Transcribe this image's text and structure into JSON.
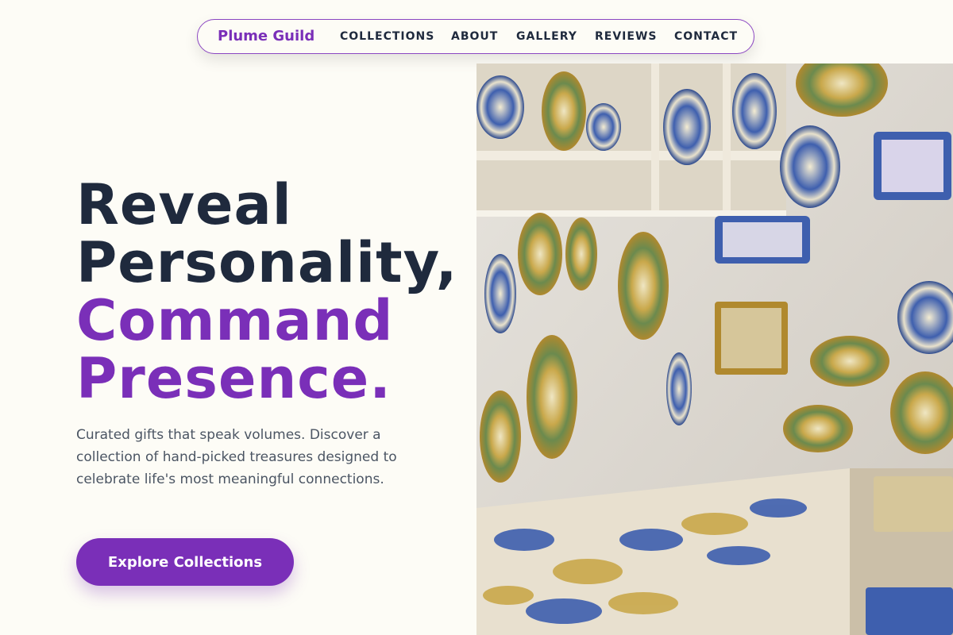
{
  "nav": {
    "brand": "Plume Guild",
    "links": [
      "COLLECTIONS",
      "ABOUT",
      "GALLERY",
      "REVIEWS",
      "CONTACT"
    ]
  },
  "hero": {
    "title_line1": "Reveal",
    "title_line2": "Personality,",
    "title_line3": "Command",
    "title_line4": "Presence.",
    "description": "Curated gifts that speak volumes. Discover a collection of hand-picked treasures designed to celebrate life's most meaningful connections.",
    "cta_label": "Explore Collections"
  },
  "colors": {
    "accent": "#7a2fb8",
    "heading": "#1f2a3d",
    "background": "#fdfcf6"
  }
}
